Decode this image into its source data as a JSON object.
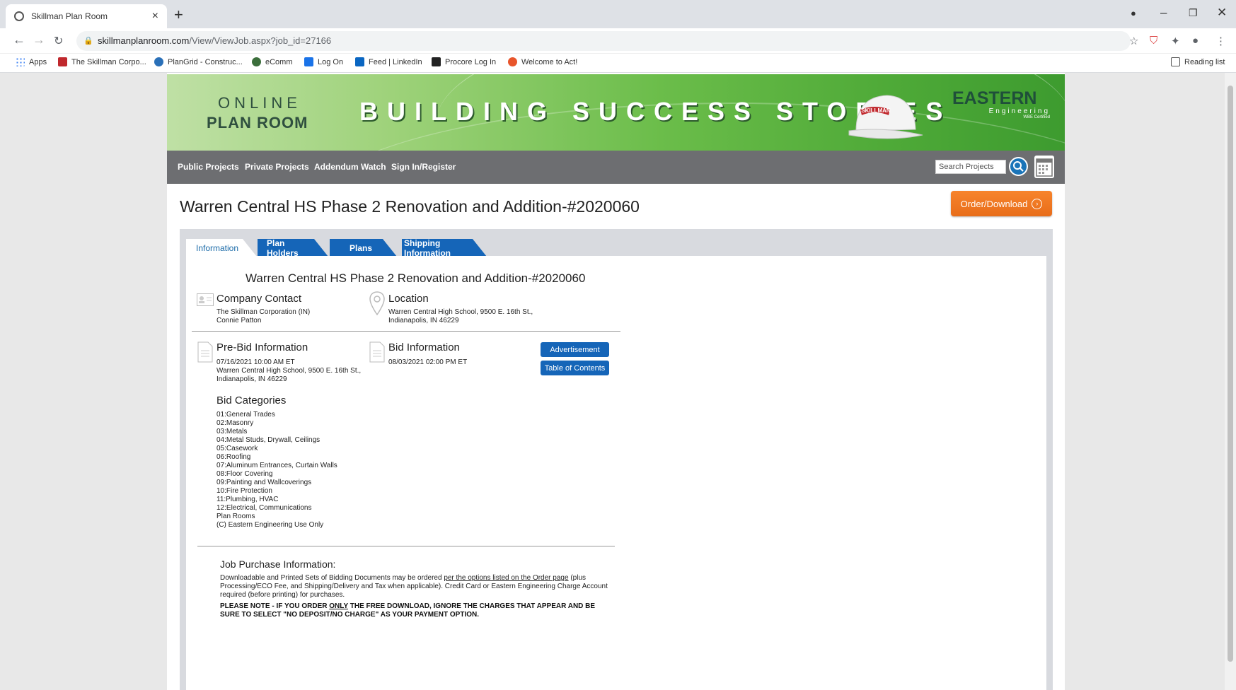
{
  "browser": {
    "tab_title": "Skillman Plan Room",
    "url_host": "skillmanplanroom.com",
    "url_path": "/View/ViewJob.aspx?job_id=27166",
    "bookmarks": [
      "Apps",
      "The Skillman Corpo...",
      "PlanGrid - Construc...",
      "eComm",
      "Log On",
      "Feed | LinkedIn",
      "Procore Log In",
      "Welcome to Act!"
    ],
    "reading_list": "Reading list"
  },
  "banner": {
    "line1": "ONLINE",
    "line2": "PLAN ROOM",
    "tagline": "BUILDING SUCCESS STORIES",
    "hat_label": "SKILLMAN",
    "partner_name": "EASTERN",
    "partner_sub": "Engineering",
    "partner_note": "WBE Certified"
  },
  "nav": {
    "items": [
      "Public Projects",
      "Private Projects",
      "Addendum Watch",
      "Sign In/Register"
    ],
    "search_placeholder": "Search Projects"
  },
  "project": {
    "title": "Warren Central HS Phase 2 Renovation and Addition-#2020060",
    "order_button": "Order/Download",
    "tabs": [
      "Information",
      "Plan Holders",
      "Plans",
      "Shipping Information"
    ],
    "company_contact": {
      "heading": "Company Contact",
      "line1": "The Skillman Corporation (IN)",
      "line2": "Connie Patton"
    },
    "location": {
      "heading": "Location",
      "line1": "Warren Central High School, 9500 E. 16th St.,",
      "line2": "Indianapolis, IN 46229"
    },
    "pre_bid": {
      "heading": "Pre-Bid Information",
      "line1": "07/16/2021 10:00 AM ET",
      "line2": "Warren Central High School, 9500 E. 16th St.,",
      "line3": "Indianapolis, IN 46229"
    },
    "bid": {
      "heading": "Bid Information",
      "line1": "08/03/2021 02:00 PM ET"
    },
    "buttons": {
      "advertisement": "Advertisement",
      "toc": "Table of Contents"
    },
    "bid_categories": {
      "heading": "Bid Categories",
      "items": [
        "01:General Trades",
        "02:Masonry",
        "03:Metals",
        "04:Metal Studs, Drywall, Ceilings",
        "05:Casework",
        "06:Roofing",
        "07:Aluminum Entrances, Curtain Walls",
        "08:Floor Covering",
        "09:Painting and Wallcoverings",
        "10:Fire Protection",
        "11:Plumbing, HVAC",
        "12:Electrical, Communications",
        "Plan Rooms",
        "(C) Eastern Engineering Use Only"
      ]
    },
    "purchase": {
      "heading": "Job Purchase Information:",
      "text_before": "Downloadable and Printed Sets of Bidding Documents may be ordered ",
      "link": "per the options listed on the Order page",
      "text_after": " (plus Processing/ECO Fee, and Shipping/Delivery and Tax when applicable). Credit Card or Eastern Engineering Charge Account required (before printing) for purchases.",
      "warn_before": "PLEASE NOTE - IF YOU ORDER ",
      "warn_only": "ONLY",
      "warn_after": " THE FREE DOWNLOAD, IGNORE THE CHARGES THAT APPEAR AND BE SURE TO SELECT \"NO DEPOSIT/NO CHARGE\" AS YOUR PAYMENT OPTION."
    }
  },
  "colors": {
    "nav_bg": "#6d6e71",
    "tab_blue": "#1565b8",
    "order_orange": "#f7842c",
    "banner_green": "#6bbd4a"
  }
}
